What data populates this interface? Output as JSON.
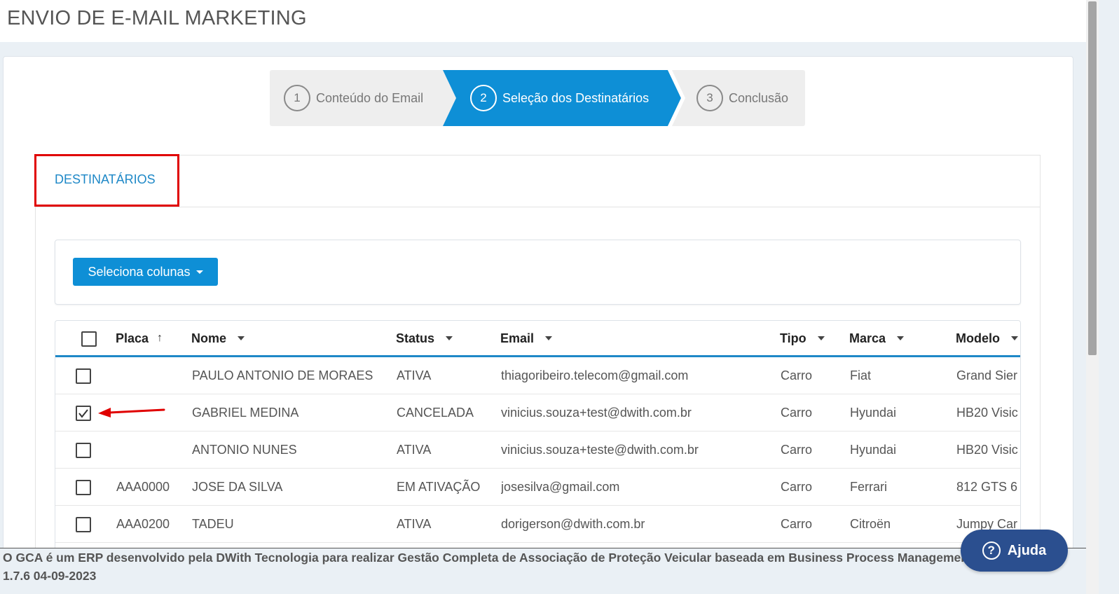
{
  "page": {
    "title": "ENVIO DE E-MAIL MARKETING"
  },
  "wizard": {
    "steps": [
      {
        "number": "1",
        "label": "Conteúdo do Email"
      },
      {
        "number": "2",
        "label": "Seleção dos Destinatários"
      },
      {
        "number": "3",
        "label": "Conclusão"
      }
    ],
    "active_step": 2,
    "active_color": "#0e8fd6"
  },
  "tabs": {
    "destinatarios": "DESTINATÁRIOS"
  },
  "toolbar": {
    "select_columns_label": "Seleciona colunas"
  },
  "table": {
    "columns": [
      "Placa",
      "Nome",
      "Status",
      "Email",
      "Tipo",
      "Marca",
      "Modelo"
    ],
    "rows": [
      {
        "checked": false,
        "placa": "",
        "nome": "PAULO ANTONIO DE MORAES",
        "status": "ATIVA",
        "email": "thiagoribeiro.telecom@gmail.com",
        "tipo": "Carro",
        "marca": "Fiat",
        "modelo": "Grand Sier"
      },
      {
        "checked": true,
        "placa": "",
        "nome": "GABRIEL MEDINA",
        "status": "CANCELADA",
        "email": "vinicius.souza+test@dwith.com.br",
        "tipo": "Carro",
        "marca": "Hyundai",
        "modelo": "HB20 Visic"
      },
      {
        "checked": false,
        "placa": "",
        "nome": "ANTONIO NUNES",
        "status": "ATIVA",
        "email": "vinicius.souza+teste@dwith.com.br",
        "tipo": "Carro",
        "marca": "Hyundai",
        "modelo": "HB20 Visic"
      },
      {
        "checked": false,
        "placa": "AAA0000",
        "nome": "JOSE DA SILVA",
        "status": "EM ATIVAÇÃO",
        "email": "josesilva@gmail.com",
        "tipo": "Carro",
        "marca": "Ferrari",
        "modelo": "812 GTS 6"
      },
      {
        "checked": false,
        "placa": "AAA0200",
        "nome": "TADEU",
        "status": "ATIVA",
        "email": "dorigerson@dwith.com.br",
        "tipo": "Carro",
        "marca": "Citroën",
        "modelo": "Jumpy Car"
      }
    ]
  },
  "footer": {
    "text": "O GCA é um ERP desenvolvido pela DWith Tecnologia para realizar Gestão Completa de Associação de Proteção Veicular baseada em Business Process Management (BPM)",
    "version": "1.7.6 04-09-2023"
  },
  "help": {
    "label": "Ajuda"
  },
  "colors": {
    "accent": "#0e8fd6",
    "highlight": "#e00000",
    "help_bg": "#2b4f8f"
  }
}
